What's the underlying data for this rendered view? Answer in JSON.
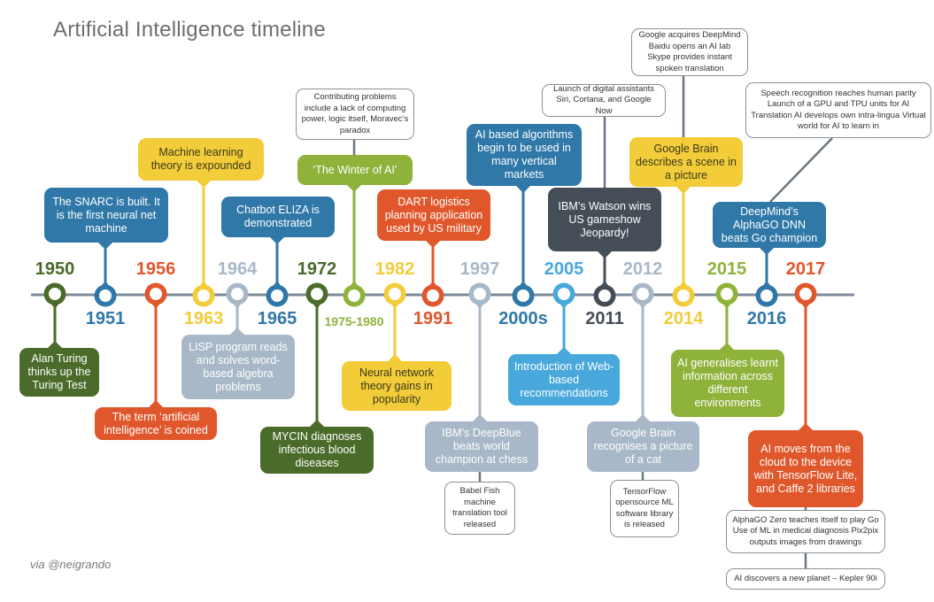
{
  "title": "Artificial Intelligence timeline",
  "credit": "via @neigrando",
  "colors": {
    "axis": "#7c8a99",
    "dark_green": "#4a6b2a",
    "blue": "#2f78a8",
    "orange": "#e0572c",
    "yellow": "#f3cc3a",
    "grey": "#a8b8c8",
    "olive": "#8fb23a",
    "light_blue": "#48a8dc",
    "charcoal": "#454e57",
    "note_stem": "#6b7782"
  },
  "events": [
    {
      "year": "1950",
      "color": "dark_green",
      "label_side": "up",
      "box_side": "down",
      "text": "Alan Turing thinks up the Turing Test"
    },
    {
      "year": "1951",
      "color": "blue",
      "label_side": "down",
      "box_side": "up",
      "text": "The SNARC is built. It is the first neural net machine"
    },
    {
      "year": "1956",
      "color": "orange",
      "label_side": "up",
      "box_side": "down",
      "text": "The term ‘artificial intelligence’ is coined"
    },
    {
      "year": "1963",
      "color": "yellow",
      "label_side": "down",
      "box_side": "up",
      "text": "Machine learning theory is expounded",
      "dark_text": true
    },
    {
      "year": "1964",
      "color": "grey",
      "label_side": "up",
      "box_side": "down",
      "text": "LISP program reads and solves word-based algebra problems"
    },
    {
      "year": "1965",
      "color": "blue",
      "label_side": "down",
      "box_side": "up",
      "text": "Chatbot ELIZA is demonstrated"
    },
    {
      "year": "1972",
      "color": "dark_green",
      "label_side": "up",
      "box_side": "down",
      "text": "MYCIN diagnoses infectious blood diseases"
    },
    {
      "year": "1975-1980",
      "color": "olive",
      "label_side": "down",
      "box_side": "up",
      "text": "‘The Winter of AI’",
      "note": "Contributing problems include a lack of computing power, logic itself, Moravec’s paradox"
    },
    {
      "year": "1982",
      "color": "yellow",
      "label_side": "up",
      "box_side": "down",
      "text": "Neural network theory gains in popularity",
      "dark_text": true
    },
    {
      "year": "1991",
      "color": "orange",
      "label_side": "down",
      "box_side": "up",
      "text": "DART logistics planning application used by US military"
    },
    {
      "year": "1997",
      "color": "grey",
      "label_side": "up",
      "box_side": "down",
      "text": "IBM’s DeepBlue beats world champion at chess",
      "note": "Babel Fish machine translation tool released"
    },
    {
      "year": "2000s",
      "color": "blue",
      "label_side": "down",
      "box_side": "up",
      "text": "AI based algorithms begin to be used in many vertical markets"
    },
    {
      "year": "2005",
      "color": "light_blue",
      "label_side": "up",
      "box_side": "down",
      "text": "Introduction of Web-based recommendations"
    },
    {
      "year": "2011",
      "color": "charcoal",
      "label_side": "down",
      "box_side": "up",
      "text": "IBM’s Watson wins US gameshow Jeopardy!",
      "note": "Launch of digital assistants Siri, Cortana, and Google Now"
    },
    {
      "year": "2012",
      "color": "grey",
      "label_side": "up",
      "box_side": "down",
      "text": "Google Brain recognises a picture of a cat",
      "note": "TensorFlow opensource ML software library is released"
    },
    {
      "year": "2014",
      "color": "yellow",
      "label_side": "down",
      "box_side": "up",
      "text": "Google Brain describes a scene in a picture",
      "dark_text": true,
      "note": "Google acquires DeepMind Baidu opens an AI lab Skype provides instant spoken translation"
    },
    {
      "year": "2015",
      "color": "olive",
      "label_side": "up",
      "box_side": "down",
      "text": "AI generalises learnt information across different environments"
    },
    {
      "year": "2016",
      "color": "blue",
      "label_side": "down",
      "box_side": "up",
      "text": "DeepMind’s AlphaGO DNN beats Go champion",
      "note": "Speech recognition reaches human parity Launch of a GPU and TPU units for AI Translation AI develops own intra-lingua Virtual world for AI to learn in"
    },
    {
      "year": "2017",
      "color": "orange",
      "label_side": "up",
      "box_side": "down",
      "text": "AI moves from the cloud to the device with TensorFlow Lite, and Caffe 2 libraries",
      "notes": [
        "AlphaGO Zero teaches itself to play Go Use of ML in medical diagnosis Pix2pix outputs images from drawings",
        "AI discovers a new planet – Kepler 90i"
      ]
    }
  ]
}
